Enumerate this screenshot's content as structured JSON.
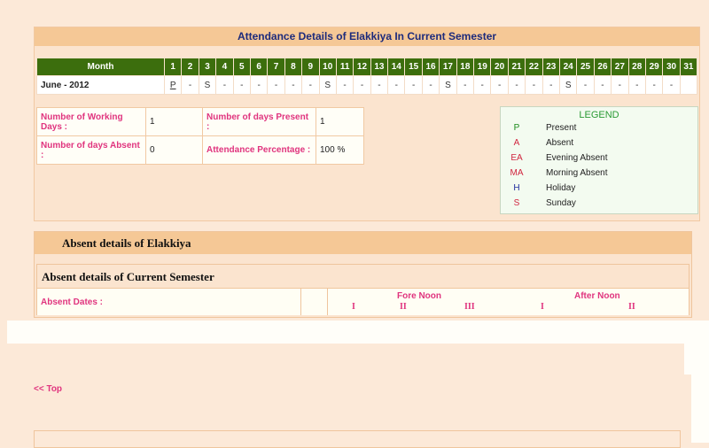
{
  "title": "Attendance Details of Elakkiya In Current Semester",
  "month_header": "Month",
  "days": [
    "1",
    "2",
    "3",
    "4",
    "5",
    "6",
    "7",
    "8",
    "9",
    "10",
    "11",
    "12",
    "13",
    "14",
    "15",
    "16",
    "17",
    "18",
    "19",
    "20",
    "21",
    "22",
    "23",
    "24",
    "25",
    "26",
    "27",
    "28",
    "29",
    "30",
    "31"
  ],
  "month_row": {
    "label": "June - 2012",
    "statuses": [
      "P",
      "-",
      "S",
      "-",
      "-",
      "-",
      "-",
      "-",
      "-",
      "S",
      "-",
      "-",
      "-",
      "-",
      "-",
      "-",
      "S",
      "-",
      "-",
      "-",
      "-",
      "-",
      "-",
      "S",
      "-",
      "-",
      "-",
      "-",
      "-",
      "-",
      ""
    ]
  },
  "summary": {
    "working_days_label": "Number of Working Days :",
    "working_days_value": "1",
    "present_label": "Number of days Present :",
    "present_value": "1",
    "absent_label": "Number of days Absent :",
    "absent_value": "0",
    "percentage_label": "Attendance Percentage :",
    "percentage_value": "100 %"
  },
  "legend": {
    "title": "LEGEND",
    "items": [
      {
        "code": "P",
        "desc": "Present"
      },
      {
        "code": "A",
        "desc": "Absent"
      },
      {
        "code": "EA",
        "desc": "Evening Absent"
      },
      {
        "code": "MA",
        "desc": "Morning Absent"
      },
      {
        "code": "H",
        "desc": "Holiday"
      },
      {
        "code": "S",
        "desc": "Sunday"
      }
    ]
  },
  "absent": {
    "outer_title": "Absent details of Elakkiya",
    "inner_title": "Absent details of Current Semester",
    "dates_label": "Absent Dates :",
    "fore_noon_label": "Fore Noon",
    "after_noon_label": "After Noon",
    "fore_sessions": [
      "I",
      "II",
      "III"
    ],
    "after_sessions": [
      "I",
      "II"
    ]
  },
  "top_link": "<< Top",
  "colors": {
    "month_header_bg": "#3c6e0d",
    "title_bar_bg": "#f5c896",
    "title_text": "#1d2b7c",
    "label_pink": "#e0347e",
    "present_green": "#1a8a1a",
    "sunday_red": "#d0243e"
  }
}
